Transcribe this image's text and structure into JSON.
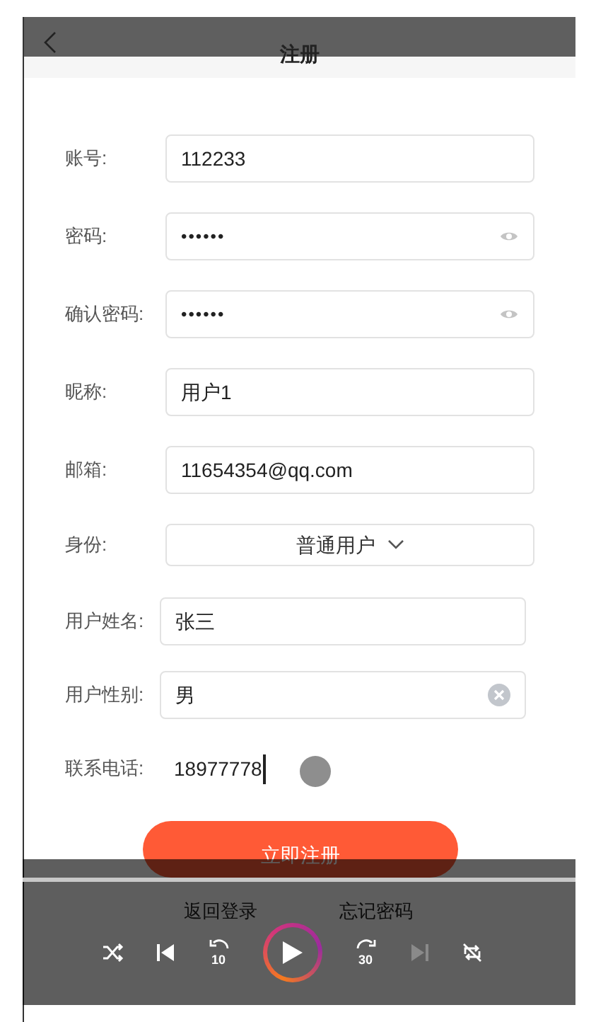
{
  "header": {
    "title": "注册"
  },
  "account_fields": [
    {
      "label": "账号:",
      "kind": "text",
      "value": "112233"
    },
    {
      "label": "密码:",
      "kind": "password",
      "value": "••••••"
    },
    {
      "label": "确认密码:",
      "kind": "password",
      "value": "••••••"
    },
    {
      "label": "昵称:",
      "kind": "text",
      "value": "用户1"
    },
    {
      "label": "邮箱:",
      "kind": "text",
      "value": "11654354@qq.com"
    },
    {
      "label": "身份:",
      "kind": "select",
      "value": "普通用户"
    }
  ],
  "profile_fields": [
    {
      "label": "用户姓名:",
      "kind": "text",
      "value": "张三"
    },
    {
      "label": "用户性别:",
      "kind": "clearable",
      "value": "男"
    },
    {
      "label": "联系电话:",
      "kind": "focused",
      "value": "18977778"
    }
  ],
  "submit": "立即注册",
  "links": [
    "返回登录",
    "忘记密码"
  ],
  "player": {
    "controls": [
      {
        "kind": "shuffle",
        "disabled": false
      },
      {
        "kind": "previous",
        "disabled": false
      },
      {
        "kind": "rewind",
        "text": "10",
        "disabled": false
      },
      {
        "kind": "play",
        "disabled": false
      },
      {
        "kind": "forward",
        "text": "30",
        "disabled": false
      },
      {
        "kind": "next",
        "disabled": true
      },
      {
        "kind": "repeat",
        "disabled": false
      }
    ]
  }
}
